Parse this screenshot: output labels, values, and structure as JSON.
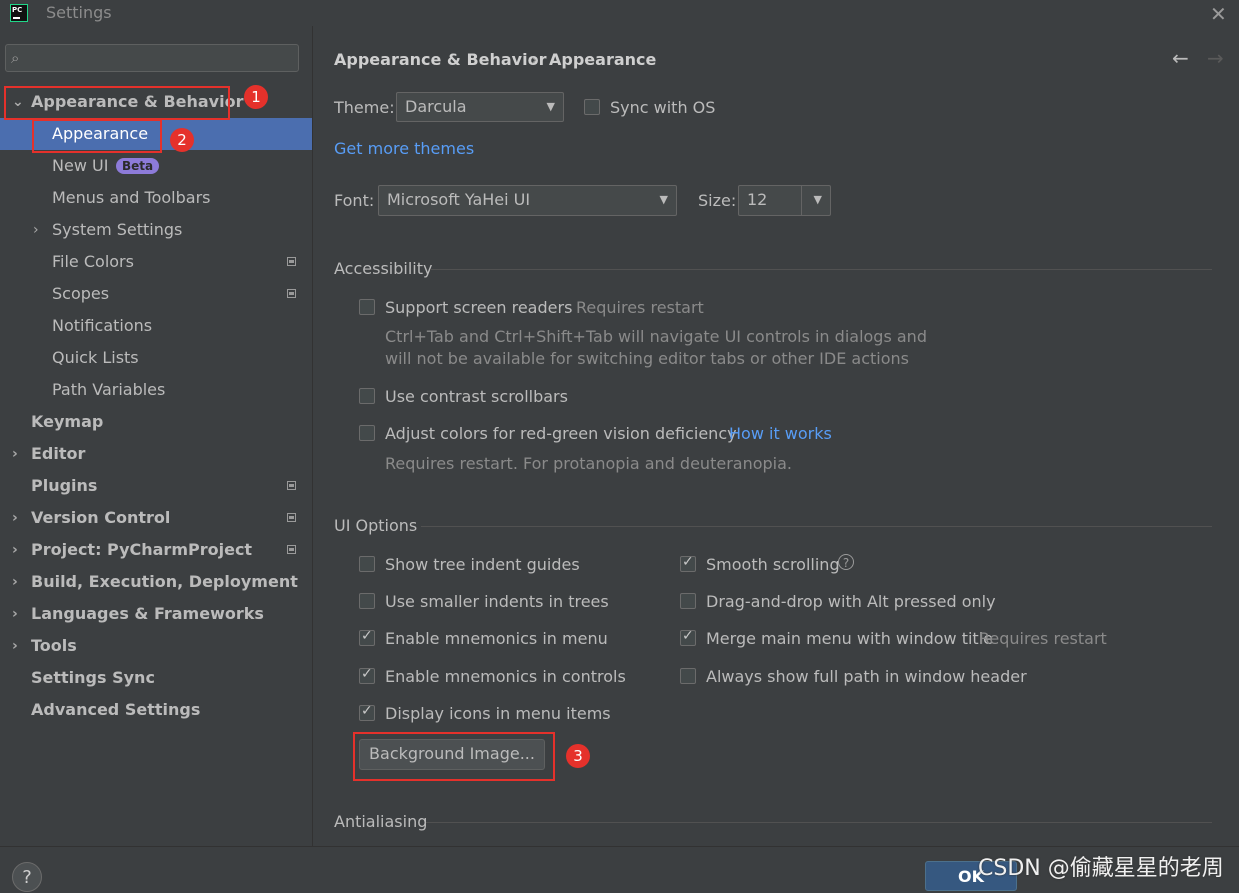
{
  "window": {
    "title": "Settings"
  },
  "search": {
    "placeholder": ""
  },
  "sidebar": {
    "items": [
      {
        "label": "Appearance & Behavior",
        "badge": ""
      },
      {
        "label": "Appearance"
      },
      {
        "label": "New UI",
        "badge": "Beta"
      },
      {
        "label": "Menus and Toolbars"
      },
      {
        "label": "System Settings"
      },
      {
        "label": "File Colors"
      },
      {
        "label": "Scopes"
      },
      {
        "label": "Notifications"
      },
      {
        "label": "Quick Lists"
      },
      {
        "label": "Path Variables"
      },
      {
        "label": "Keymap"
      },
      {
        "label": "Editor"
      },
      {
        "label": "Plugins"
      },
      {
        "label": "Version Control"
      },
      {
        "label": "Project: PyCharmProject"
      },
      {
        "label": "Build, Execution, Deployment"
      },
      {
        "label": "Languages & Frameworks"
      },
      {
        "label": "Tools"
      },
      {
        "label": "Settings Sync"
      },
      {
        "label": "Advanced Settings"
      }
    ]
  },
  "annotations": {
    "n1": "1",
    "n2": "2",
    "n3": "3"
  },
  "breadcrumb": {
    "parent": "Appearance & Behavior",
    "separator": "›",
    "current": "Appearance"
  },
  "theme": {
    "label": "Theme:",
    "value": "Darcula",
    "sync_label": "Sync with OS",
    "more_link": "Get more themes"
  },
  "font": {
    "label": "Font:",
    "value": "Microsoft YaHei UI",
    "size_label": "Size:",
    "size_value": "12"
  },
  "accessibility": {
    "title": "Accessibility",
    "screen_readers": "Support screen readers",
    "screen_readers_note": "Requires restart",
    "screen_readers_desc1": "Ctrl+Tab and Ctrl+Shift+Tab will navigate UI controls in dialogs and",
    "screen_readers_desc2": "will not be available for switching editor tabs or other IDE actions",
    "contrast_scrollbars": "Use contrast scrollbars",
    "color_deficiency": "Adjust colors for red-green vision deficiency",
    "how_it_works": "How it works",
    "color_deficiency_note": "Requires restart. For protanopia and deuteranopia."
  },
  "ui_options": {
    "title": "UI Options",
    "left": [
      {
        "label": "Show tree indent guides",
        "checked": false
      },
      {
        "label": "Use smaller indents in trees",
        "checked": false
      },
      {
        "label": "Enable mnemonics in menu",
        "checked": true
      },
      {
        "label": "Enable mnemonics in controls",
        "checked": true
      },
      {
        "label": "Display icons in menu items",
        "checked": true
      }
    ],
    "right": [
      {
        "label": "Smooth scrolling",
        "checked": true
      },
      {
        "label": "Drag-and-drop with Alt pressed only",
        "checked": false
      },
      {
        "label": "Merge main menu with window title",
        "checked": true,
        "note": "Requires restart"
      },
      {
        "label": "Always show full path in window header",
        "checked": false
      }
    ],
    "background_image_button": "Background Image..."
  },
  "antialiasing": {
    "title": "Antialiasing"
  },
  "footer": {
    "help": "?",
    "ok": "OK"
  },
  "watermark": "CSDN @偷藏星星的老周"
}
